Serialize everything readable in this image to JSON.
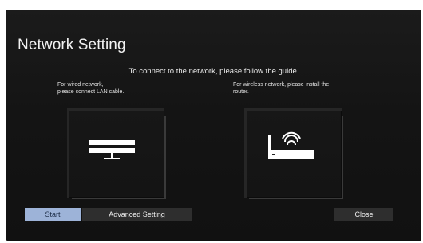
{
  "window": {
    "title": "Network Setting",
    "guide_text": "To connect to the network, please follow the guide."
  },
  "wired": {
    "description_line1": "For wired network,",
    "description_line2": "please connect LAN cable.",
    "icon": "lan-device-icon"
  },
  "wireless": {
    "description_line1": "For wireless network, please install the",
    "description_line2": "router.",
    "icon": "wireless-router-icon"
  },
  "buttons": {
    "start": "Start",
    "advanced": "Advanced Setting",
    "close": "Close"
  },
  "colors": {
    "background": "#141414",
    "text": "#f2f2f2",
    "selected_button": "#9db3d8",
    "button": "#2e2e2e"
  }
}
